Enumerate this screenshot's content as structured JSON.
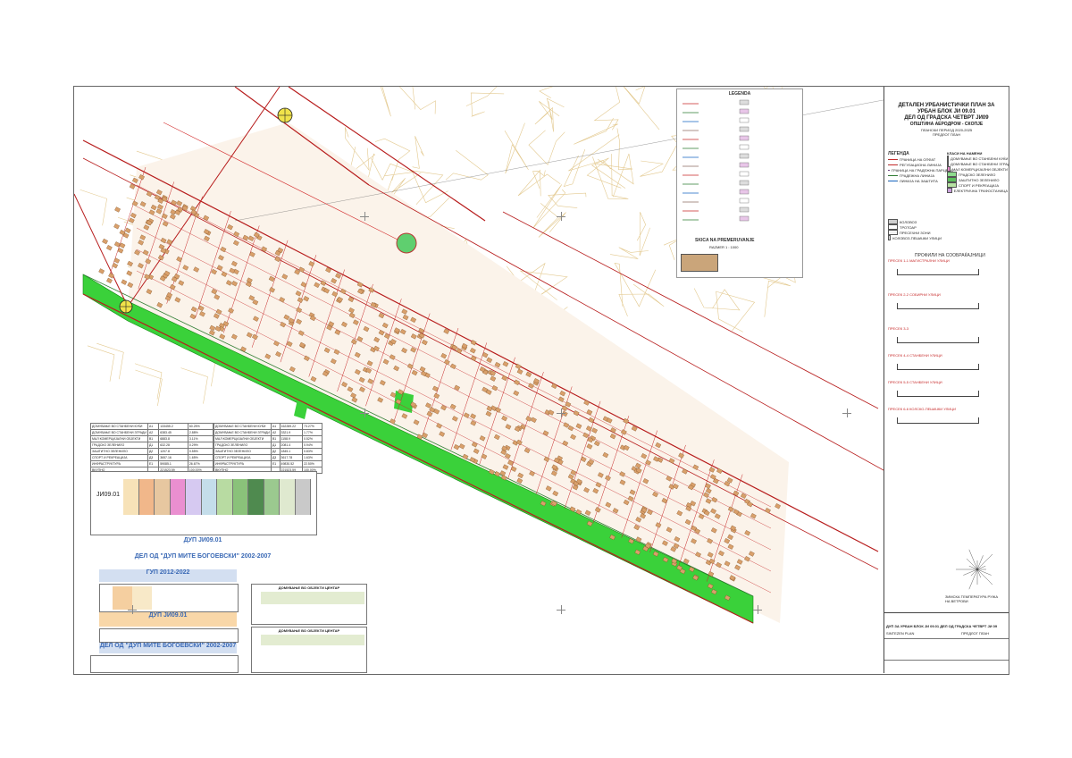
{
  "title_block": {
    "title_line1": "ДЕТАЛЕН УРБАНИСТИЧКИ ПЛАН ЗА",
    "title_line2": "УРБАН БЛОК ЈИ 09.01",
    "title_line3": "ДЕЛ ОД ГРАДСКА ЧЕТВРТ ЈИ09",
    "municipality": "ОПШТИНА АЕРОДРОМ - СКОПЈЕ",
    "period": "ПЛАНСКИ ПЕРИОД 2020-2025",
    "stage": "ПРЕДЛОГ ПЛАН",
    "footer_name": "ДУП ЗА УРБАН БЛОК ЈИ 09.01 ДЕЛ ОД ГРАДСКА ЧЕТВРТ ЈИ 09",
    "footer_plan": "ПРЕДЛОГ ПЛАН",
    "footer_sheet": "SINTEZEN PLAN"
  },
  "legend": {
    "heading": "ЛЕГЕНДА",
    "class_heading": "КЛАСИ НА НАМЕНИ",
    "items": [
      "ГРАНИЦА НА ОПФАТ",
      "РЕГУЛАЦИОНА ЛИНИЈА",
      "ГРАНИЦА НА ГРАДЕЖНА ПАРЦЕЛА",
      "ГРАДЕЖНА ЛИНИЈА",
      "ЛИНИЈА НА ЗАШТИТА"
    ],
    "classes": [
      "ДОМУВАЊЕ ВО СТАНБЕНИ КУЌИ",
      "ДОМУВАЊЕ ВО СТАНБЕНИ ЗГРАДИ",
      "МАЛ КОМЕРЦИЈАЛНИ ОБЈЕКТИ",
      "ГРАДСКО ЗЕЛЕНИЛО",
      "ЗАШТИТНО ЗЕЛЕНИЛО",
      "СПОРТ И РЕКРЕАЦИЈА",
      "ЕЛЕКТРИЧНА ТРАФОСТАНИЦА"
    ],
    "roads": [
      "КОЛОВОЗ",
      "ТРОТОАР",
      "ПРЕСЕЧНИ ЗОНИ",
      "КОЛОВОЗ-ПЕШАЧКИ УЛИЦИ"
    ]
  },
  "sketch_legend": {
    "heading": "LEGENDA",
    "skica_title": "SKICA NA PREMERUVANJE",
    "skica_scale": "RAZMER 1 : 1000"
  },
  "profiles": {
    "heading": "ПРОФИЛИ НА СООБРАЌАЈНИЦИ",
    "sections": [
      "ПРЕСЕК 1-1 МАГИСТРАЛНИ УЛИЦИ",
      "ПРЕСЕК 2-2 СОБИРНИ УЛИЦИ",
      "ПРЕСЕК 3-3",
      "ПРЕСЕК 4-4 СТАНБЕНИ УЛИЦИ",
      "ПРЕСЕК 5-5 СТАНБЕНИ УЛИЦИ",
      "ПРЕСЕК 6-6 КОЛСКО-ПЕШАЧКИ УЛИЦИ"
    ]
  },
  "tables": {
    "code": "ЈИ09.01",
    "banner1": "ДУП ЈИ09.01",
    "banner2": "ДЕЛ ОД \"ДУП МИТЕ БОГОЕВСКИ\" 2002-2007",
    "banner3": "ГУП 2012-2022",
    "banner4": "ДУП ЈИ09.01",
    "banner5": "ДЕЛ ОД \"ДУП МИТЕ БОГОЕВСКИ\" 2002-2007",
    "table_a_rows": [
      [
        "ДОМУВАЊЕ ВО СТАНБЕНИ КУЌИ",
        "А1",
        "133455.2",
        "60.25%"
      ],
      [
        "ДОМУВАЊЕ ВО СТАНБЕНИ ЗГРАДИ",
        "А2",
        "6383.45",
        "2.88%"
      ],
      [
        "МАЛ КОМЕРЦИЈАЛНИ ОБЈЕКТИ",
        "В1",
        "6883.8",
        "3.11%"
      ],
      [
        "ГРАДСКО ЗЕЛЕНИЛО",
        "Д1",
        "632.28",
        "0.29%"
      ],
      [
        "ЗАШТИТНО ЗЕЛЕНИЛО",
        "Д2",
        "1207.8",
        "0.55%"
      ],
      [
        "СПОРТ И РЕКРЕАЦИЈА",
        "Д3",
        "3657.16",
        "1.65%"
      ],
      [
        "ИНФРАСТРУКТУРА",
        "Е1",
        "59085.1",
        "26.67%"
      ],
      [
        "ВКУПНО",
        "",
        "221523.59",
        "100.00%"
      ]
    ],
    "table_b_rows": [
      [
        "ДОМУВАЊЕ ВО СТАНБЕНИ КУЌИ",
        "А1",
        "162289.22",
        "73.27%"
      ],
      [
        "ДОМУВАЊЕ ВО СТАНБЕНИ ЗГРАДИ",
        "А2",
        "3321.9",
        "1.77%"
      ],
      [
        "МАЛ КОМЕРЦИЈАЛНИ ОБЈЕКТИ",
        "В1",
        "1158.9",
        "0.52%"
      ],
      [
        "ГРАДСКО ЗЕЛЕНИЛО",
        "Д1",
        "2081.4",
        "0.94%"
      ],
      [
        "ЗАШТИТНО ЗЕЛЕНИЛО",
        "Д2",
        "1845.1",
        "0.83%"
      ],
      [
        "СПОРТ И РЕКРЕАЦИЈА",
        "Д3",
        "3617.78",
        "1.63%"
      ],
      [
        "ИНФРАСТРУКТУРА",
        "Е1",
        "49830.52",
        "22.50%"
      ],
      [
        "ВКУПНО",
        "",
        "221523.59",
        "100.00%"
      ]
    ],
    "bottom_heading1": "ДОМУВАЊЕ ВО ОБЈЕКТИ ЦЕНТАР",
    "bottom_heading2": "ДОМУВАЊЕ ВО ОБЈЕКТИ ЦЕНТАР"
  },
  "map": {
    "north_label": "N",
    "wind_rose_label": "ЗИМСКА ТЕМПЕРАТУРА РУЖА НА ВЕТРОВИ"
  }
}
